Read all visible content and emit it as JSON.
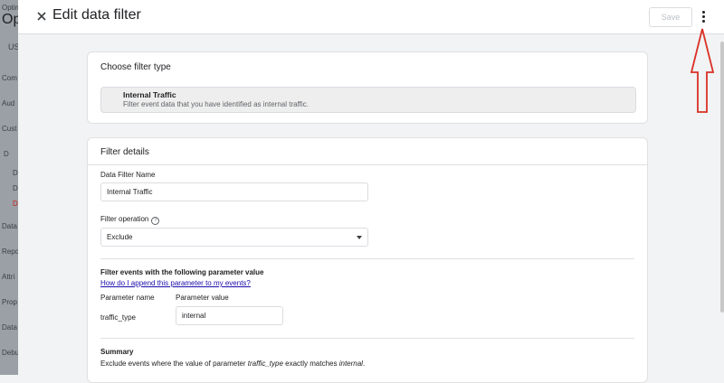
{
  "background_app": {
    "items": [
      "Optim",
      "Opt",
      "US",
      "Com",
      "Aud",
      "Cust",
      "D",
      "D",
      "D",
      "D",
      "Data",
      "Repo",
      "Attri",
      "Prop",
      "Data",
      "Debu"
    ]
  },
  "header": {
    "title": "Edit data filter",
    "save_label": "Save"
  },
  "filter_type_card": {
    "title": "Choose filter type",
    "selected_name": "Internal Traffic",
    "selected_description": "Filter event data that you have identified as internal traffic."
  },
  "details_card": {
    "title": "Filter details",
    "name_label": "Data Filter Name",
    "name_value": "Internal Traffic",
    "operation_label": "Filter operation",
    "operation_value": "Exclude",
    "param_section_title": "Filter events with the following parameter value",
    "param_help_link": "How do I append this parameter to my events?",
    "param_name_header": "Parameter name",
    "param_value_header": "Parameter value",
    "param_name": "traffic_type",
    "param_value": "internal",
    "summary_title": "Summary",
    "summary_prefix": "Exclude events where the value of parameter ",
    "summary_param": "traffic_type",
    "summary_middle": " exactly matches ",
    "summary_value": "internal",
    "summary_suffix": "."
  },
  "colors": {
    "annotation_arrow": "#d93025",
    "link": "#1a0dab"
  }
}
